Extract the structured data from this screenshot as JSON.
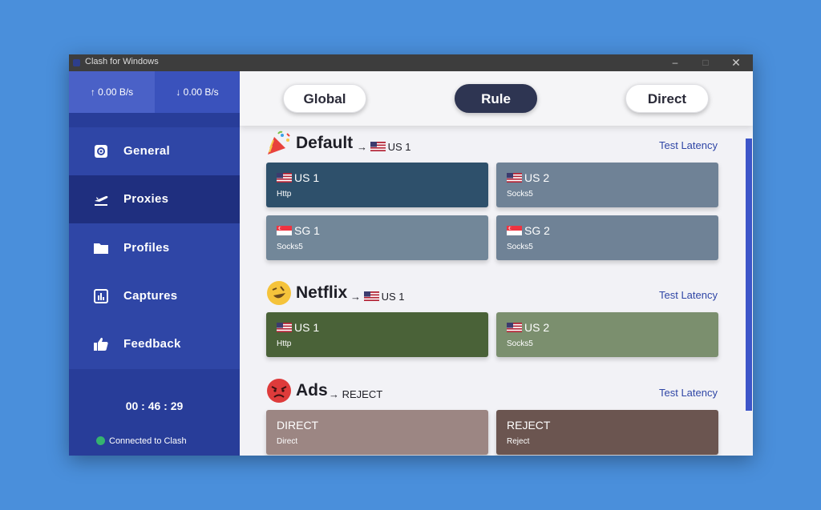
{
  "window": {
    "title": "Clash for Windows",
    "minimize": "–",
    "maximize": "□",
    "close": "✕"
  },
  "sidebar": {
    "upload": "↑ 0.00 B/s",
    "download": "↓ 0.00 B/s",
    "items": [
      {
        "label": "General",
        "icon": "gear-icon"
      },
      {
        "label": "Proxies",
        "icon": "plane-icon",
        "active": true
      },
      {
        "label": "Profiles",
        "icon": "folder-icon"
      },
      {
        "label": "Captures",
        "icon": "chart-icon"
      },
      {
        "label": "Feedback",
        "icon": "thumbs-up-icon"
      }
    ],
    "timer": "00 : 46 : 29",
    "status": "Connected to Clash",
    "status_color": "#35b36f"
  },
  "modes": {
    "global": "Global",
    "rule": "Rule",
    "direct": "Direct",
    "selected": "Rule"
  },
  "groups": [
    {
      "name": "Default",
      "arrow": "→",
      "selected": "US 1",
      "selected_flag": "us",
      "test": "Test Latency",
      "emoji": "party-popper-icon",
      "proxies": [
        {
          "name": "US 1",
          "type": "Http",
          "flag": "us",
          "color": "#2e506b",
          "selected": true
        },
        {
          "name": "US 2",
          "type": "Socks5",
          "flag": "us",
          "color": "#6f8296"
        },
        {
          "name": "SG 1",
          "type": "Socks5",
          "flag": "sg",
          "color": "#728799"
        },
        {
          "name": "SG 2",
          "type": "Socks5",
          "flag": "sg",
          "color": "#6f8296"
        }
      ]
    },
    {
      "name": "Netflix",
      "arrow": "→",
      "selected": "US 1",
      "selected_flag": "us",
      "test": "Test Latency",
      "emoji": "rofl-face-icon",
      "proxies": [
        {
          "name": "US 1",
          "type": "Http",
          "flag": "us",
          "color": "#4a6238",
          "selected": true
        },
        {
          "name": "US 2",
          "type": "Socks5",
          "flag": "us",
          "color": "#7b8f6e"
        }
      ]
    },
    {
      "name": "Ads",
      "arrow": "→",
      "selected": "REJECT",
      "test": "Test Latency",
      "emoji": "angry-face-icon",
      "proxies": [
        {
          "name": "DIRECT",
          "type": "Direct",
          "color": "#9c8683"
        },
        {
          "name": "REJECT",
          "type": "Reject",
          "color": "#6b5550",
          "selected": true
        }
      ]
    }
  ]
}
